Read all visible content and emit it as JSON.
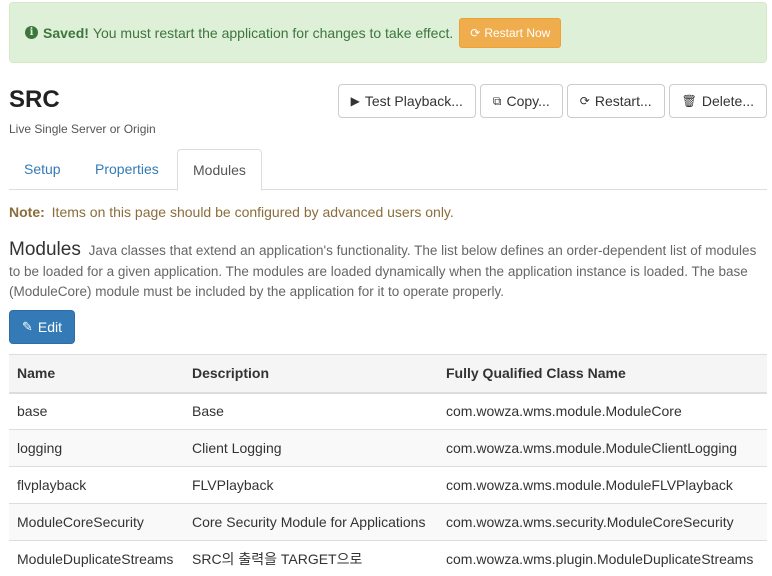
{
  "alert": {
    "strong": "Saved!",
    "message": "You must restart the application for changes to take effect.",
    "button": "Restart Now"
  },
  "header": {
    "title": "SRC",
    "subtitle": "Live Single Server or Origin"
  },
  "toolbar": {
    "test_playback": "Test Playback...",
    "copy": "Copy...",
    "restart": "Restart...",
    "delete": "Delete..."
  },
  "tabs": [
    {
      "label": "Setup"
    },
    {
      "label": "Properties"
    },
    {
      "label": "Modules"
    }
  ],
  "note": {
    "strong": "Note:",
    "text": "Items on this page should be configured by advanced users only."
  },
  "modules": {
    "heading": "Modules",
    "description": "Java classes that extend an application's functionality. The list below defines an order-dependent list of modules to be loaded for a given application. The modules are loaded dynamically when the application instance is loaded. The base (ModuleCore) module must be included by the application for it to operate properly.",
    "edit_button": "Edit"
  },
  "table": {
    "headers": [
      "Name",
      "Description",
      "Fully Qualified Class Name"
    ],
    "rows": [
      [
        "base",
        "Base",
        "com.wowza.wms.module.ModuleCore"
      ],
      [
        "logging",
        "Client Logging",
        "com.wowza.wms.module.ModuleClientLogging"
      ],
      [
        "flvplayback",
        "FLVPlayback",
        "com.wowza.wms.module.ModuleFLVPlayback"
      ],
      [
        "ModuleCoreSecurity",
        "Core Security Module for Applications",
        "com.wowza.wms.security.ModuleCoreSecurity"
      ],
      [
        "ModuleDuplicateStreams",
        "SRC의 출력을 TARGET으로",
        "com.wowza.wms.plugin.ModuleDuplicateStreams"
      ]
    ]
  },
  "icons": {
    "info": "info-circle-icon",
    "refresh": "refresh-icon",
    "play": "play-icon",
    "copy": "copy-icon",
    "trash": "trash-icon",
    "pencil": "pencil-icon"
  },
  "colors": {
    "success_bg": "#dff0d8",
    "success_text": "#3c763d",
    "warning_button": "#f0ad4e",
    "primary": "#337ab7",
    "note_text": "#8a6d3b"
  }
}
